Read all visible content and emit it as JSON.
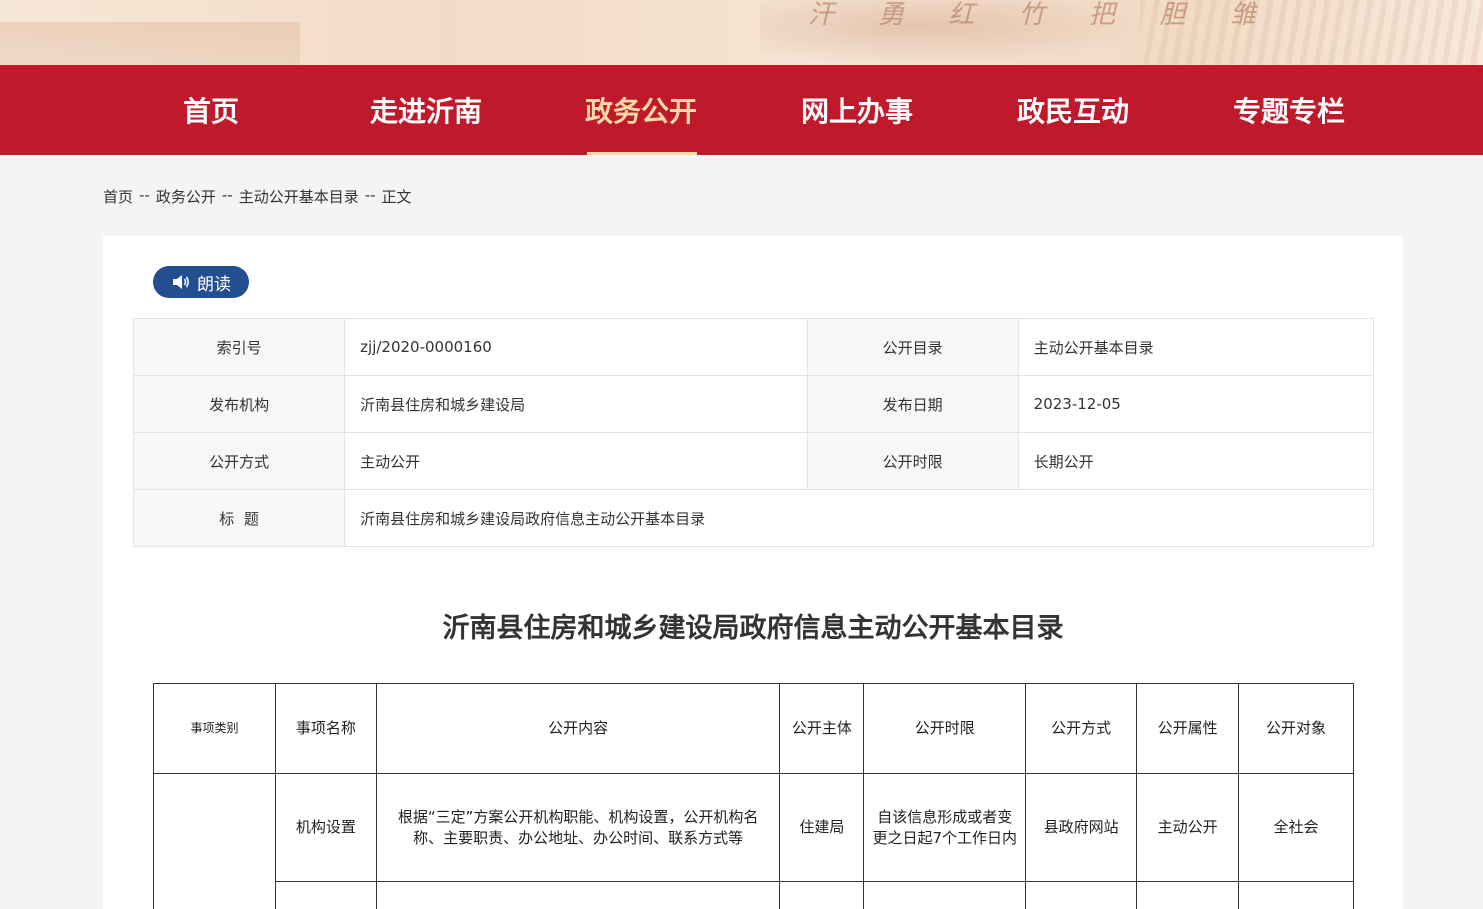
{
  "banner": {
    "calligraphy": "汗 勇 红 竹 把 胆 雏"
  },
  "nav": {
    "items": [
      {
        "label": "首页",
        "active": false
      },
      {
        "label": "走进沂南",
        "active": false
      },
      {
        "label": "政务公开",
        "active": true
      },
      {
        "label": "网上办事",
        "active": false
      },
      {
        "label": "政民互动",
        "active": false
      },
      {
        "label": "专题专栏",
        "active": false
      }
    ]
  },
  "breadcrumb": {
    "items": [
      "首页",
      "政务公开",
      "主动公开基本目录",
      "正文"
    ],
    "separator": "--"
  },
  "read_button": {
    "label": "朗读",
    "icon": "speaker-icon"
  },
  "meta": {
    "index_label": "索引号",
    "index_value": "zjj/2020-0000160",
    "catalog_label": "公开目录",
    "catalog_value": "主动公开基本目录",
    "publisher_label": "发布机构",
    "publisher_value": "沂南县住房和城乡建设局",
    "date_label": "发布日期",
    "date_value": "2023-12-05",
    "method_label": "公开方式",
    "method_value": "主动公开",
    "period_label": "公开时限",
    "period_value": "长期公开",
    "title_label": "标  题",
    "title_value": "沂南县住房和城乡建设局政府信息主动公开基本目录"
  },
  "doc_title": "沂南县住房和城乡建设局政府信息主动公开基本目录",
  "catalog_table": {
    "headers": [
      "事项类别",
      "事项名称",
      "公开内容",
      "公开主体",
      "公开时限",
      "公开方式",
      "公开属性",
      "公开对象"
    ],
    "rows": [
      {
        "category": "",
        "name": "机构设置",
        "content": "根据“三定”方案公开机构职能、机构设置，公开机构名称、主要职责、办公地址、办公时间、联系方式等",
        "subject": "住建局",
        "period": "自该信息形成或者变更之日起7个工作日内",
        "method": "县政府网站",
        "attribute": "主动公开",
        "audience": "全社会"
      }
    ]
  },
  "colors": {
    "nav_bg": "#c0192b",
    "nav_active": "#ffd9a8",
    "read_btn": "#234e8f"
  }
}
